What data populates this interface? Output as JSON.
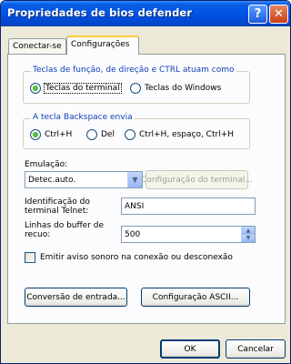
{
  "window": {
    "title": "Propriedades de bios defender",
    "help_glyph": "?",
    "close_glyph": "✕"
  },
  "tabs": [
    {
      "label": "Conectar-se",
      "selected": false
    },
    {
      "label": "Configurações",
      "selected": true
    }
  ],
  "keys_group": {
    "title": "Teclas de função, de direção e CTRL atuam como",
    "options": [
      {
        "label": "Teclas do terminal",
        "checked": true
      },
      {
        "label": "Teclas do Windows",
        "checked": false
      }
    ]
  },
  "backspace_group": {
    "title": "A tecla Backspace envia",
    "options": [
      {
        "label": "Ctrl+H",
        "checked": true
      },
      {
        "label": "Del",
        "checked": false
      },
      {
        "label": "Ctrl+H, espaço, Ctrl+H",
        "checked": false
      }
    ]
  },
  "emulation": {
    "label": "Emulação:",
    "value": "Detec.auto.",
    "config_button": "Configuração do terminal..."
  },
  "telnet_id": {
    "label_line1": "Identificação do",
    "label_line2": "terminal Telnet:",
    "value": "ANSI"
  },
  "buffer": {
    "label_line1": "Linhas do buffer de",
    "label_line2": "recuo:",
    "value": "500"
  },
  "sound_checkbox": {
    "label": "Emitir aviso sonoro na conexão ou desconexão",
    "checked": false
  },
  "buttons": {
    "input_conversion": "Conversão de entrada...",
    "ascii_config": "Configuração ASCII...",
    "ok": "OK",
    "cancel": "Cancelar"
  },
  "colors": {
    "titlebar": "#0054e3",
    "dialog_bg": "#ece9d8",
    "group_title": "#1040b0"
  }
}
